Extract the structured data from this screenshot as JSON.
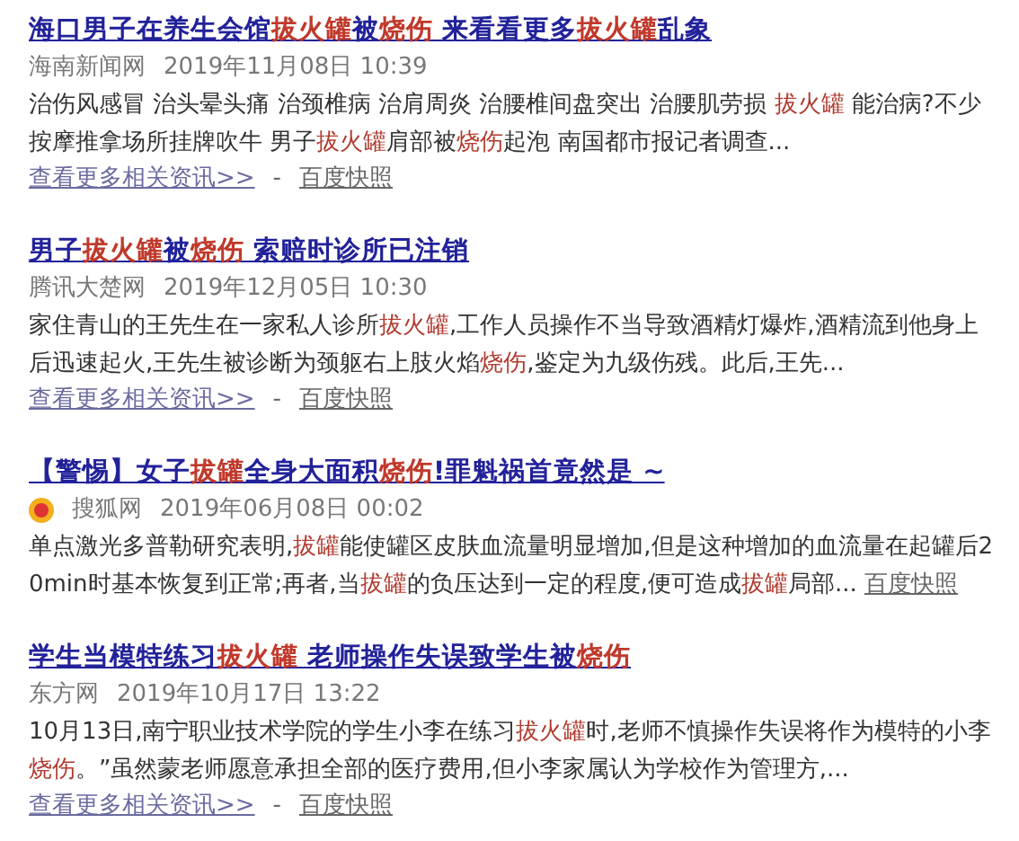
{
  "results": [
    {
      "title": [
        {
          "text": "海口男子在养生会馆",
          "highlight": false
        },
        {
          "text": "拔火罐",
          "highlight": true
        },
        {
          "text": "被",
          "highlight": false
        },
        {
          "text": "烧伤",
          "highlight": true
        },
        {
          "text": " 来看看更多",
          "highlight": false
        },
        {
          "text": "拔火罐",
          "highlight": true
        },
        {
          "text": "乱象",
          "highlight": false
        }
      ],
      "source_icon": false,
      "source": "海南新闻网",
      "time": "2019年11月08日 10:39",
      "summary": [
        {
          "text": "治伤风感冒 治头晕头痛 治颈椎病 治肩周炎 治腰椎间盘突出 治腰肌劳损 ",
          "highlight": false
        },
        {
          "text": "拔火罐",
          "highlight": true
        },
        {
          "text": " 能治病?不少按摩推拿场所挂牌吹牛 男子",
          "highlight": false
        },
        {
          "text": "拔火罐",
          "highlight": true
        },
        {
          "text": "肩部被",
          "highlight": false
        },
        {
          "text": "烧伤",
          "highlight": true
        },
        {
          "text": "起泡 南国都市报记者调查...",
          "highlight": false
        }
      ],
      "more_link": "查看更多相关资讯>>",
      "separator": "-",
      "snapshot": "百度快照"
    },
    {
      "title": [
        {
          "text": "男子",
          "highlight": false
        },
        {
          "text": "拔火罐",
          "highlight": true
        },
        {
          "text": "被",
          "highlight": false
        },
        {
          "text": "烧伤",
          "highlight": true
        },
        {
          "text": " 索赔时诊所已注销",
          "highlight": false
        }
      ],
      "source_icon": false,
      "source": "腾讯大楚网",
      "time": "2019年12月05日 10:30",
      "summary": [
        {
          "text": "家住青山的王先生在一家私人诊所",
          "highlight": false
        },
        {
          "text": "拔火罐",
          "highlight": true
        },
        {
          "text": ",工作人员操作不当导致酒精灯爆炸,酒精流到他身上后迅速起火,王先生被诊断为颈躯右上肢火焰",
          "highlight": false
        },
        {
          "text": "烧伤",
          "highlight": true
        },
        {
          "text": ",鉴定为九级伤残。此后,王先...",
          "highlight": false
        }
      ],
      "more_link": "查看更多相关资讯>>",
      "separator": "-",
      "snapshot": "百度快照"
    },
    {
      "title": [
        {
          "text": "【警惕】女子",
          "highlight": false
        },
        {
          "text": "拔罐",
          "highlight": true
        },
        {
          "text": "全身大面积",
          "highlight": false
        },
        {
          "text": "烧伤",
          "highlight": true
        },
        {
          "text": "!罪魁祸首竟然是 ~",
          "highlight": false
        }
      ],
      "source_icon": true,
      "source": "搜狐网",
      "time": "2019年06月08日 00:02",
      "summary": [
        {
          "text": "单点激光多普勒研究表明,",
          "highlight": false
        },
        {
          "text": "拔罐",
          "highlight": true
        },
        {
          "text": "能使罐区皮肤血流量明显增加,但是这种增加的血流量在起罐后20min时基本恢复到正常;再者,当",
          "highlight": false
        },
        {
          "text": "拔罐",
          "highlight": true
        },
        {
          "text": "的负压达到一定的程度,便可造成",
          "highlight": false
        },
        {
          "text": "拔罐",
          "highlight": true
        },
        {
          "text": "局部...",
          "highlight": false
        }
      ],
      "snapshot": "百度快照"
    },
    {
      "title": [
        {
          "text": "学生当模特练习",
          "highlight": false
        },
        {
          "text": "拔火罐",
          "highlight": true
        },
        {
          "text": " 老师操作失误致学生被",
          "highlight": false
        },
        {
          "text": "烧伤",
          "highlight": true
        }
      ],
      "source_icon": false,
      "source": "东方网",
      "time": "2019年10月17日 13:22",
      "summary": [
        {
          "text": "10月13日,南宁职业技术学院的学生小李在练习",
          "highlight": false
        },
        {
          "text": "拔火罐",
          "highlight": true
        },
        {
          "text": "时,老师不慎操作失误将作为模特的小李",
          "highlight": false
        },
        {
          "text": "烧伤",
          "highlight": true
        },
        {
          "text": "。”虽然蒙老师愿意承担全部的医疗费用,但小李家属认为学校作为管理方,...",
          "highlight": false
        }
      ],
      "more_link": "查看更多相关资讯>>",
      "separator": "-",
      "snapshot": "百度快照"
    }
  ]
}
